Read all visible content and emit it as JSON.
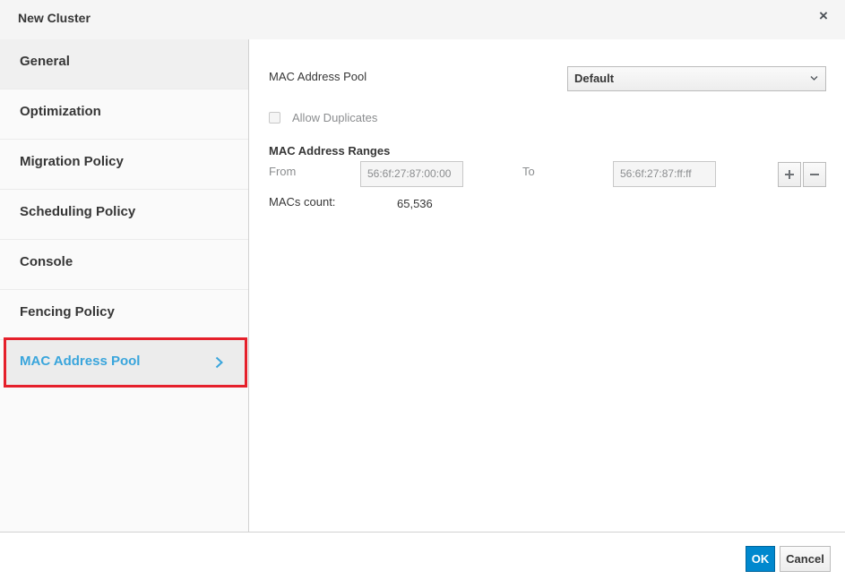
{
  "dialog": {
    "title": "New Cluster",
    "close_glyph": "×"
  },
  "sidebar": {
    "items": [
      {
        "label": "General"
      },
      {
        "label": "Optimization"
      },
      {
        "label": "Migration Policy"
      },
      {
        "label": "Scheduling Policy"
      },
      {
        "label": "Console"
      },
      {
        "label": "Fencing Policy"
      },
      {
        "label": "MAC Address Pool",
        "selected": true
      }
    ],
    "selected_icon": "chevron-right-icon"
  },
  "main": {
    "pool_label": "MAC Address Pool",
    "pool_value": "Default",
    "allow_duplicates_label": "Allow Duplicates",
    "allow_duplicates_checked": false,
    "ranges_heading": "MAC Address Ranges",
    "from_label": "From",
    "from_value": "56:6f:27:87:00:00",
    "to_label": "To",
    "to_value": "56:6f:27:87:ff:ff",
    "count_label": "MACs count:",
    "count_value": "65,536"
  },
  "footer": {
    "ok_label": "OK",
    "cancel_label": "Cancel"
  },
  "colors": {
    "accent": "#39a5dc",
    "primary_button": "#0088ce",
    "highlight_border": "#e5202b"
  }
}
